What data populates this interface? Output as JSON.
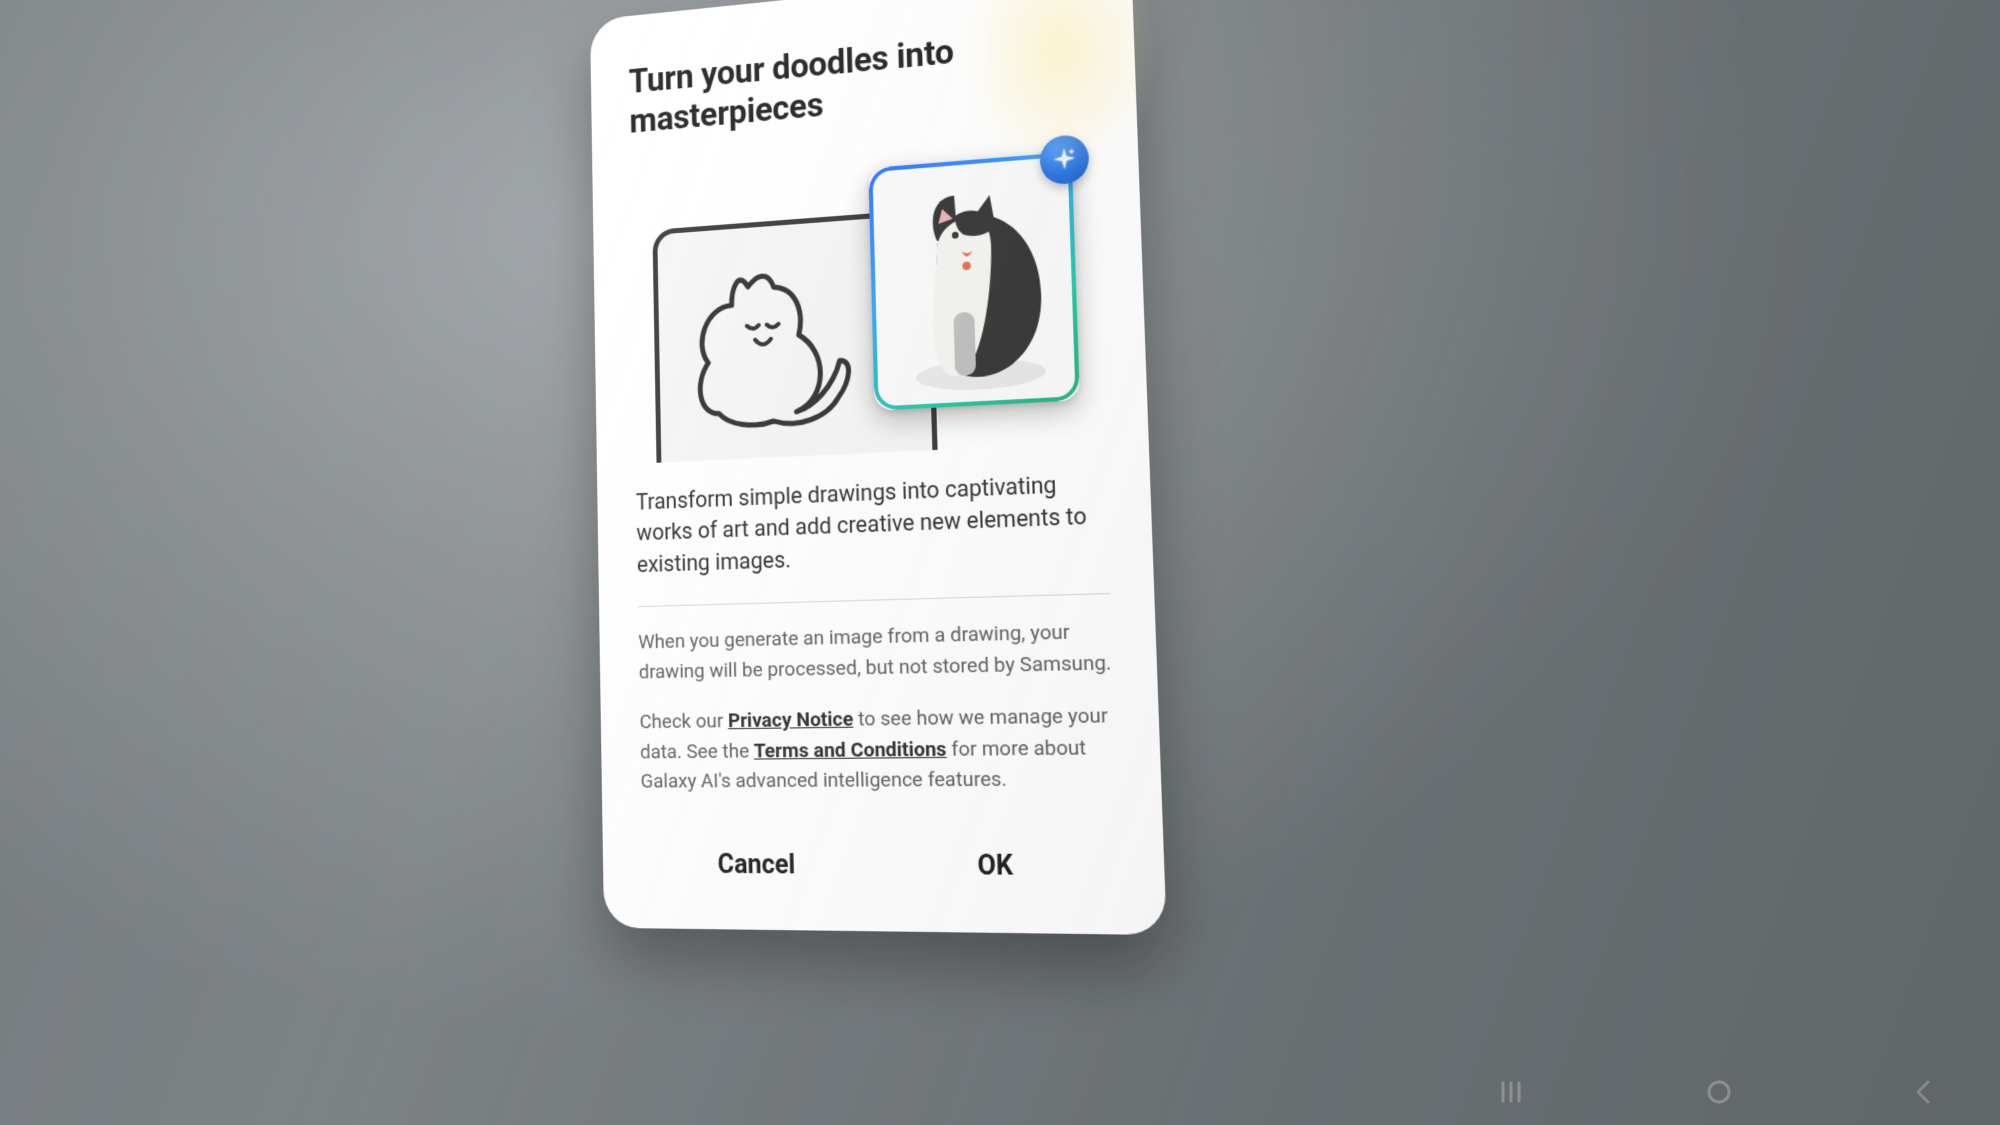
{
  "dialog": {
    "title": "Turn your doodles into masterpieces",
    "description": "Transform simple drawings into captivating works of art and add creative new elements to existing images.",
    "privacy_note": "When you generate an image from a drawing, your drawing will be processed, but not stored by Samsung.",
    "legal": {
      "prefix": "Check our ",
      "link1_label": "Privacy Notice",
      "mid1": " to see how we manage your data. See the ",
      "link2_label": "Terms and Conditions",
      "suffix": " for more about Galaxy AI's advanced intelligence features."
    },
    "buttons": {
      "cancel": "Cancel",
      "ok": "OK"
    },
    "illustration": {
      "sketch_alt": "cat-doodle",
      "art_alt": "cat-rendered",
      "badge": "sparkle"
    }
  }
}
